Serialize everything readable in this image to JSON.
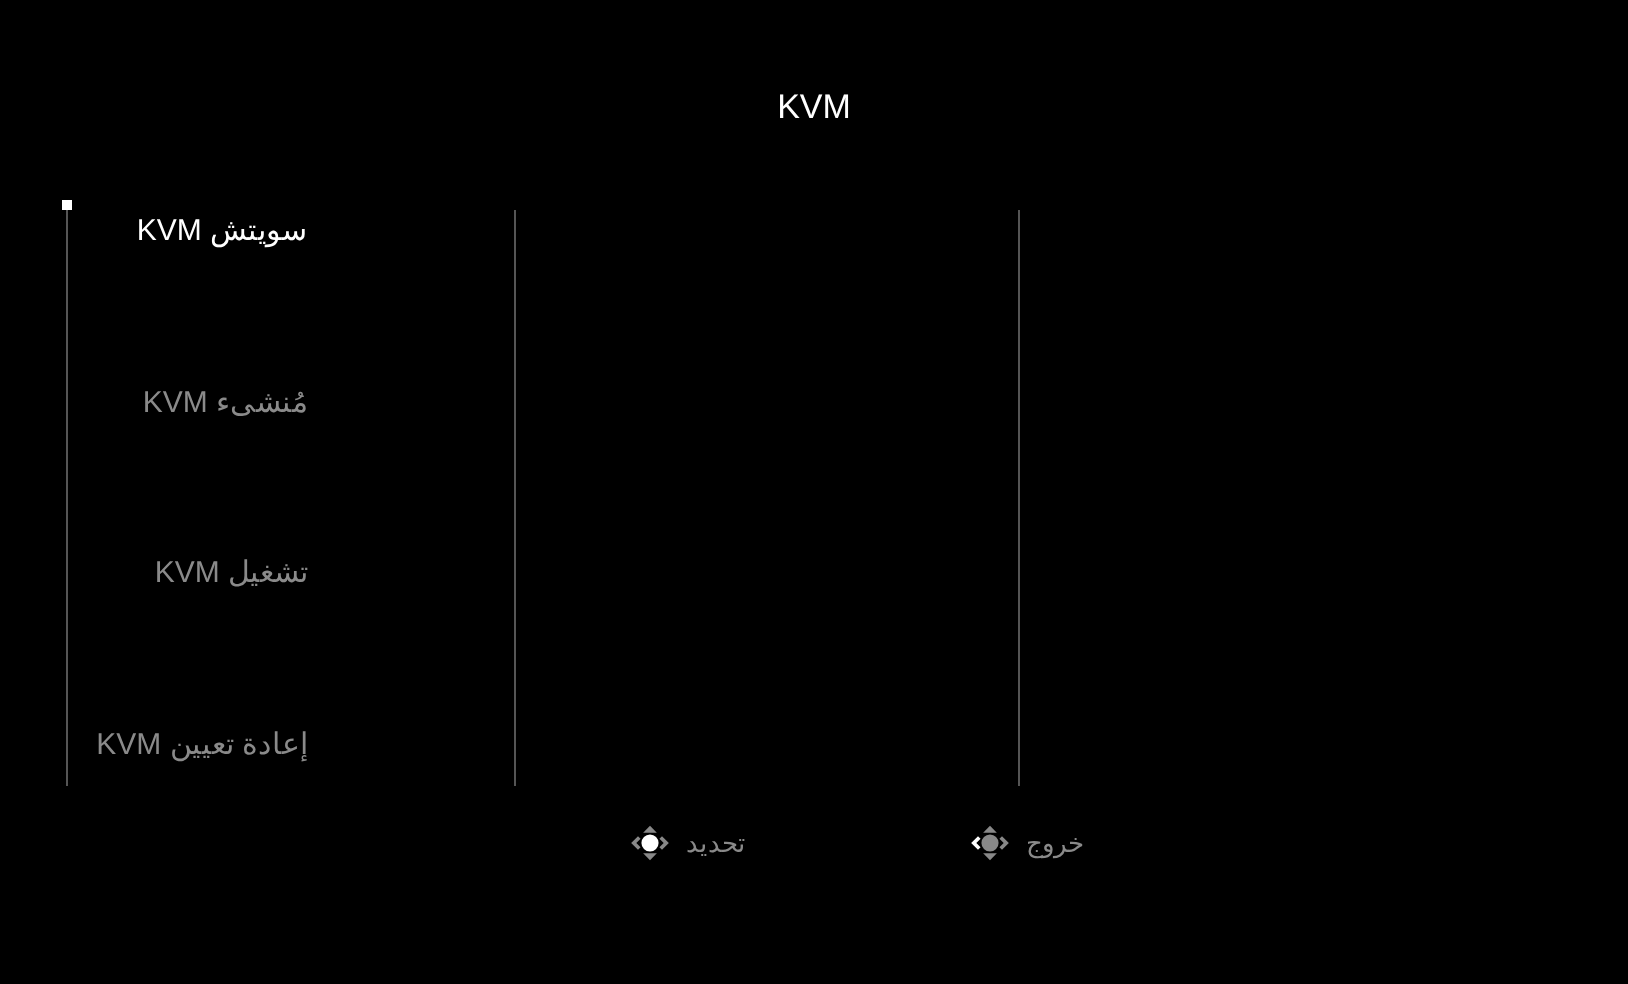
{
  "title": "KVM",
  "menu": [
    {
      "label": "سويتش KVM",
      "selected": true
    },
    {
      "label": "مُنشىء KVM",
      "selected": false
    },
    {
      "label": "تشغيل KVM",
      "selected": false
    },
    {
      "label": "إعادة تعيين KVM",
      "selected": false
    }
  ],
  "hints": [
    {
      "kind": "left",
      "label": "خروج"
    },
    {
      "kind": "press",
      "label": "تحديد"
    }
  ]
}
